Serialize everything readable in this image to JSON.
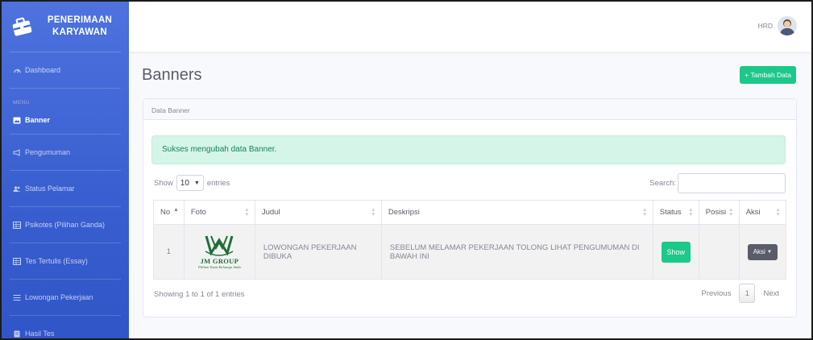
{
  "app": {
    "brand_line1": "PENERIMAAN",
    "brand_line2": "KARYAWAN"
  },
  "sidebar": {
    "section_heading": "MENU",
    "items": [
      {
        "label": "Dashboard",
        "icon": "dashboard-icon"
      },
      {
        "label": "Banner",
        "icon": "image-icon",
        "active": true
      },
      {
        "label": "Pengumuman",
        "icon": "megaphone-icon"
      },
      {
        "label": "Status Pelamar",
        "icon": "users-icon"
      },
      {
        "label": "Psikotes (Pilihan Ganda)",
        "icon": "table-icon"
      },
      {
        "label": "Tes Tertulis (Essay)",
        "icon": "table-icon"
      },
      {
        "label": "Lowongan Pekerjaan",
        "icon": "list-icon"
      },
      {
        "label": "Hasil Tes",
        "icon": "file-icon"
      }
    ]
  },
  "topbar": {
    "user_name": "HRD"
  },
  "page": {
    "title": "Banners",
    "add_button": "+ Tambah Data"
  },
  "card": {
    "header": "Data Banner",
    "alert": "Sukses mengubah data Banner.",
    "show_label": "Show",
    "entries_value": "10",
    "entries_label": "entries",
    "search_label": "Search:",
    "columns": [
      "No",
      "Foto",
      "Judul",
      "Deskripsi",
      "Status",
      "Posisi",
      "Aksi"
    ],
    "rows": [
      {
        "no": "1",
        "foto_logo_text": "JM GROUP",
        "foto_logo_tagline": "Pilihan Tepat Keluarga Anda",
        "judul": "LOWONGAN PEKERJAAN DIBUKA",
        "deskripsi": "SEBELUM MELAMAR PEKERJAAN TOLONG LIHAT PENGUMUMAN DI BAWAH INI",
        "status": "Show",
        "posisi": "",
        "aksi": "Aksi"
      }
    ],
    "info": "Showing 1 to 1 of 1 entries",
    "pagination": {
      "previous": "Previous",
      "current": "1",
      "next": "Next"
    }
  },
  "colors": {
    "sidebar": "#4e73df",
    "success": "#1cc88a",
    "alert_bg": "#d4f5e8",
    "secondary": "#5a5c69"
  }
}
